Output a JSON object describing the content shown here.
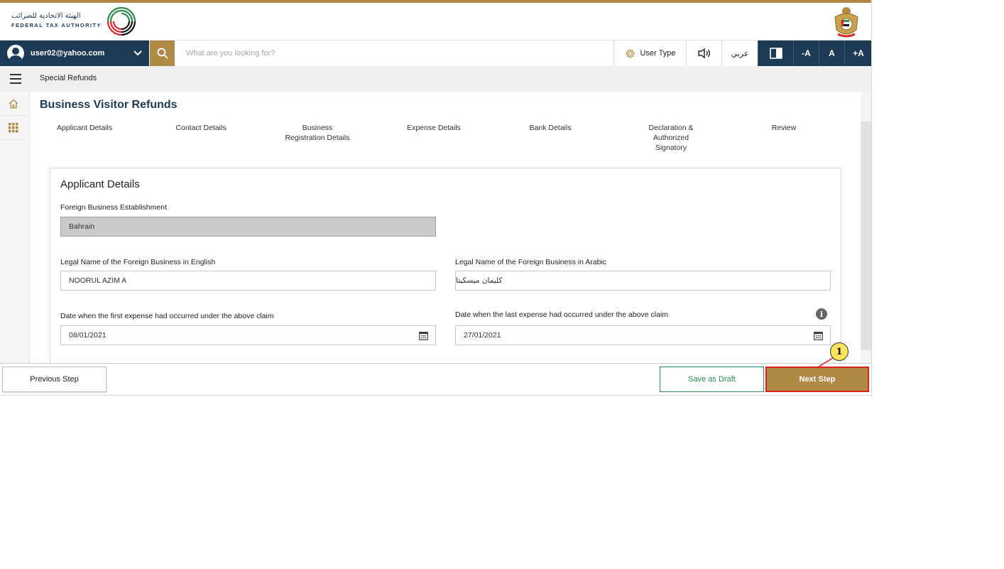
{
  "header": {
    "logo_arabic": "الهيئة الاتحادية للضرائب",
    "logo_english": "FEDERAL TAX AUTHORITY",
    "brand_colors": {
      "navy": "#1d3a55",
      "gold": "#b08a45",
      "green": "#2f8a4f",
      "red": "#d9282f"
    }
  },
  "toolbar": {
    "user_email": "user02@yahoo.com",
    "search_placeholder": "What are you looking for?",
    "user_type_label": "User Type",
    "language_label": "عربي",
    "font_decrease": "-A",
    "font_normal": "A",
    "font_increase": "+A"
  },
  "breadcrumb": {
    "current": "Special Refunds"
  },
  "page": {
    "title": "Business Visitor Refunds"
  },
  "steps": [
    {
      "label": "Applicant Details"
    },
    {
      "label": "Contact Details"
    },
    {
      "label": "Business\nRegistration Details"
    },
    {
      "label": "Expense Details"
    },
    {
      "label": "Bank Details"
    },
    {
      "label": "Declaration &\nAuthorized\nSignatory"
    },
    {
      "label": "Review"
    }
  ],
  "form": {
    "section_title": "Applicant Details",
    "establishment_label": "Foreign Business Establishment",
    "establishment_value": "Bahrain",
    "legal_name_en_label": "Legal Name of the Foreign Business in English",
    "legal_name_en_value": "NOORUL AZIM A",
    "legal_name_ar_label": "Legal Name of the Foreign Business in Arabic",
    "legal_name_ar_value": "كليمان ميسكيتا",
    "first_expense_label": "Date when the first expense had occurred under the above claim",
    "first_expense_value": "08/01/2021",
    "last_expense_label": "Date when the last expense had occurred under the above claim",
    "last_expense_value": "27/01/2021",
    "info_icon_glyph": "i"
  },
  "footer": {
    "previous_label": "Previous Step",
    "draft_label": "Save as Draft",
    "next_label": "Next Step"
  },
  "annotation": {
    "number": "1"
  }
}
